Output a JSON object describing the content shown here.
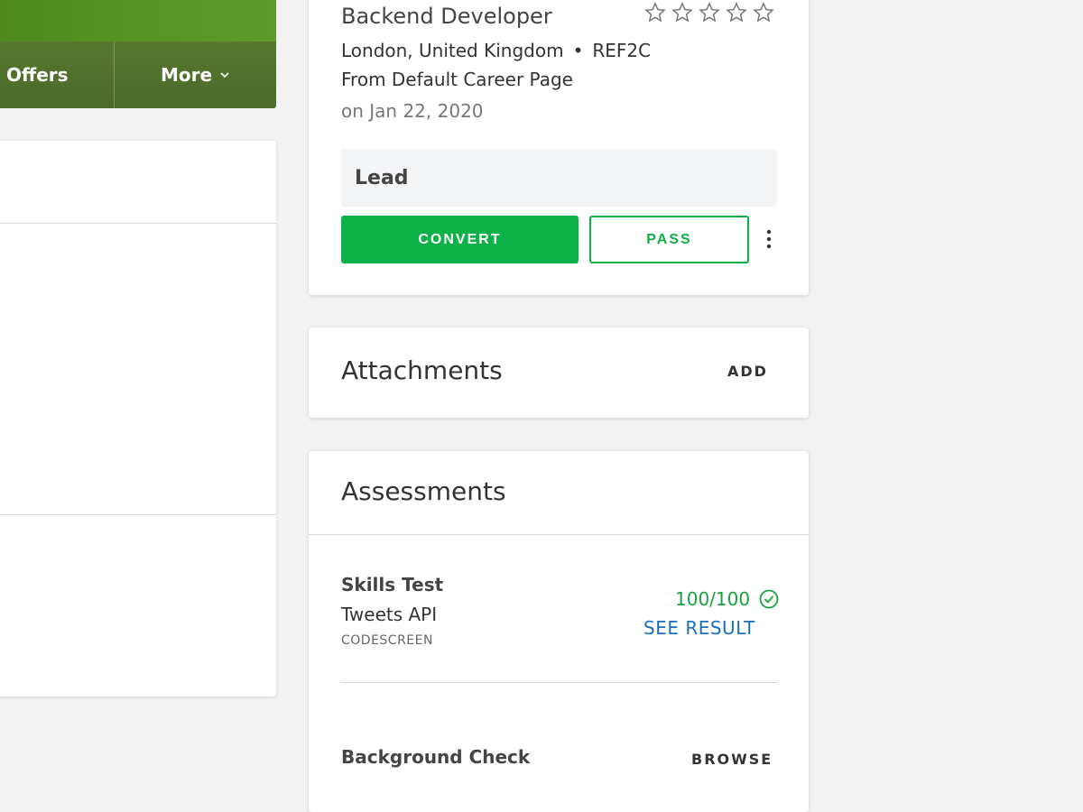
{
  "nav": {
    "tabs": [
      {
        "label": "Offers"
      },
      {
        "label": "More"
      }
    ],
    "colors": {
      "banner": "#5e9b2a",
      "bar": "#4a6a2a"
    }
  },
  "candidate": {
    "job_title": "Backend Developer",
    "location": "London, United Kingdom",
    "separator": "•",
    "reference": "REF2C",
    "source": "From Default Career Page",
    "date": "on Jan 22, 2020",
    "rating": {
      "value": 0,
      "max": 5,
      "icon": "star-outline-icon"
    },
    "stage": "Lead",
    "actions": {
      "convert_label": "CONVERT",
      "pass_label": "PASS",
      "more_icon": "kebab-menu-icon"
    },
    "colors": {
      "primary": "#0eb048"
    }
  },
  "attachments": {
    "title": "Attachments",
    "add_label": "ADD"
  },
  "assessments": {
    "title": "Assessments",
    "items": [
      {
        "name": "Skills Test",
        "test": "Tweets API",
        "vendor": "CODESCREEN",
        "score": "100/100",
        "status_icon": "check-circle-icon",
        "link_label": "SEE RESULT"
      },
      {
        "name": "Background Check",
        "action_label": "BROWSE"
      }
    ],
    "colors": {
      "score": "#18a33c",
      "link": "#1a6fbf"
    }
  }
}
